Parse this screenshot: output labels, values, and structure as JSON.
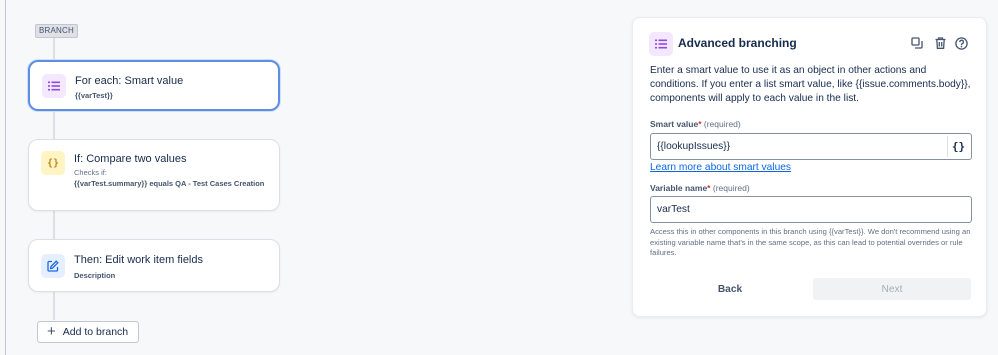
{
  "branch_tag": "BRANCH",
  "cards": [
    {
      "title": "For each: Smart value",
      "subtitle": "{{varTest}}"
    },
    {
      "title": "If: Compare two values",
      "caption": "Checks if:",
      "detail": "{{varTest.summary}} equals QA - Test Cases Creation"
    },
    {
      "title": "Then: Edit work item fields",
      "subtitle": "Description"
    }
  ],
  "add_to_branch": "Add to branch",
  "panel": {
    "title": "Advanced branching",
    "description": "Enter a smart value to use it as an object in other actions and conditions. If you enter a list smart value, like {{issue.comments.body}}, components will apply to each value in the list.",
    "smart_value_label": "Smart value",
    "smart_value_required": "(required)",
    "smart_value_input": "{{lookupIssues}}",
    "brace_button": "{}",
    "learn_more": "Learn more about smart values",
    "variable_label": "Variable name",
    "variable_required": "(required)",
    "variable_input": "varTest",
    "help_text": "Access this in other components in this branch using {{varTest}}. We don't recommend using an existing variable name that's in the same scope, as this can lead to potential overrides or rule failures.",
    "back_label": "Back",
    "next_label": "Next"
  },
  "colors": {
    "accent_blue": "#5f8ee0",
    "purple_icon": "#8f4be0",
    "yellow_icon": "#c2851a",
    "link": "#0c66e4"
  },
  "icons": [
    "list-icon",
    "braces-icon",
    "edit-icon",
    "duplicate-icon",
    "trash-icon",
    "help-icon",
    "plus-icon"
  ]
}
